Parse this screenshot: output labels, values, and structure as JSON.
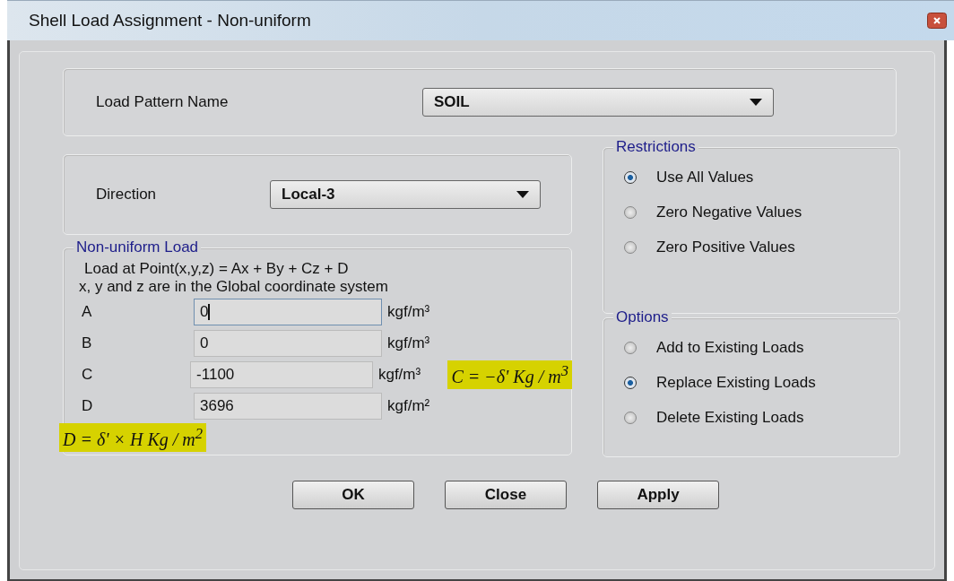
{
  "window": {
    "title": "Shell Load Assignment -  Non-uniform"
  },
  "load_pattern": {
    "label": "Load Pattern Name",
    "value": "SOIL"
  },
  "direction": {
    "label": "Direction",
    "value": "Local-3"
  },
  "non_uniform_load": {
    "title": "Non-uniform Load",
    "formula": "Load at Point(x,y,z) = Ax + By + Cz + D",
    "note": "x, y and z are in the Global coordinate system",
    "coefficients": [
      {
        "name": "A",
        "value": "0",
        "unit": "kgf/m³",
        "focused": true
      },
      {
        "name": "B",
        "value": "0",
        "unit": "kgf/m³",
        "focused": false
      },
      {
        "name": "C",
        "value": "-1100",
        "unit": "kgf/m³",
        "focused": false,
        "annotation": "C = −δ'   Kg / m$^{3}$"
      },
      {
        "name": "D",
        "value": "3696",
        "unit": "kgf/m²",
        "focused": false
      }
    ],
    "annotation": "D = δ' × H   Kg / m$^{2}$"
  },
  "restrictions": {
    "title": "Restrictions",
    "options": [
      {
        "label": "Use All Values",
        "selected": true
      },
      {
        "label": "Zero Negative Values",
        "selected": false
      },
      {
        "label": "Zero Positive Values",
        "selected": false
      }
    ]
  },
  "options": {
    "title": "Options",
    "options": [
      {
        "label": "Add to Existing Loads",
        "selected": false
      },
      {
        "label": "Replace Existing Loads",
        "selected": true
      },
      {
        "label": "Delete Existing Loads",
        "selected": false
      }
    ]
  },
  "buttons": [
    "OK",
    "Close",
    "Apply"
  ]
}
